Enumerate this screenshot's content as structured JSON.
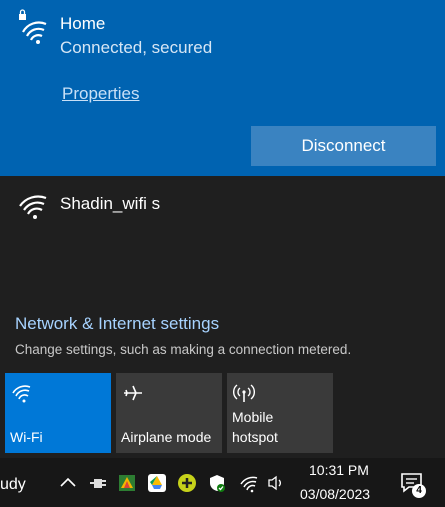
{
  "connected_network": {
    "name": "Home",
    "status": "Connected, secured",
    "properties_link": "Properties",
    "disconnect_label": "Disconnect"
  },
  "other_networks": [
    {
      "name": "Shadin_wifi s"
    }
  ],
  "settings": {
    "title": "Network & Internet settings",
    "subtitle": "Change settings, such as making a connection metered."
  },
  "quick_actions": [
    {
      "label": "Wi-Fi",
      "icon": "wifi-icon",
      "active": true
    },
    {
      "label": "Airplane mode",
      "icon": "airplane-icon",
      "active": false
    },
    {
      "label_line1": "Mobile",
      "label_line2": "hotspot",
      "icon": "hotspot-icon",
      "active": false
    }
  ],
  "taskbar": {
    "left_text": "udy",
    "time": "10:31 PM",
    "date": "03/08/2023",
    "notification_count": "4"
  },
  "colors": {
    "accent": "#0063b1",
    "tile_active": "#0078d7",
    "link": "#a7d3ff"
  }
}
